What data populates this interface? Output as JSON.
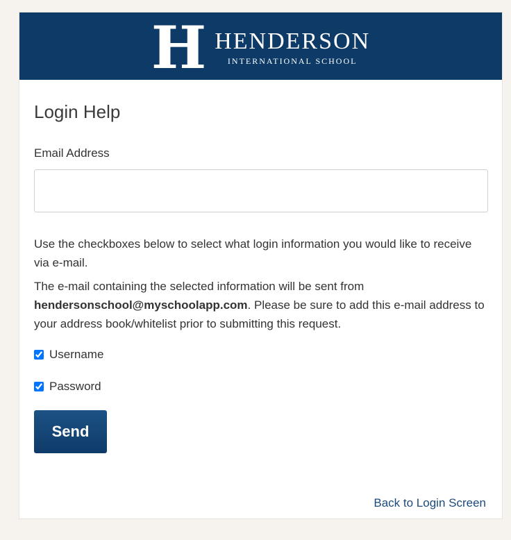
{
  "header": {
    "logo_mark": "H",
    "school_name": "HENDERSON",
    "school_subtitle": "INTERNATIONAL SCHOOL",
    "banner_color": "#0d3a66"
  },
  "form": {
    "title": "Login Help",
    "email_label": "Email Address",
    "email_value": "",
    "email_placeholder": "",
    "instructions": "Use the checkboxes below to select what login information you would like to receive via e-mail.",
    "notice_prefix": "The e-mail containing the selected information will be sent from ",
    "notice_email": "hendersonschool@myschoolapp.com",
    "notice_suffix": ". Please be sure to add this e-mail address to your address book/whitelist prior to submitting this request.",
    "checkboxes": [
      {
        "label": "Username",
        "checked": true
      },
      {
        "label": "Password",
        "checked": true
      }
    ],
    "send_label": "Send",
    "back_link": "Back to Login Screen"
  }
}
